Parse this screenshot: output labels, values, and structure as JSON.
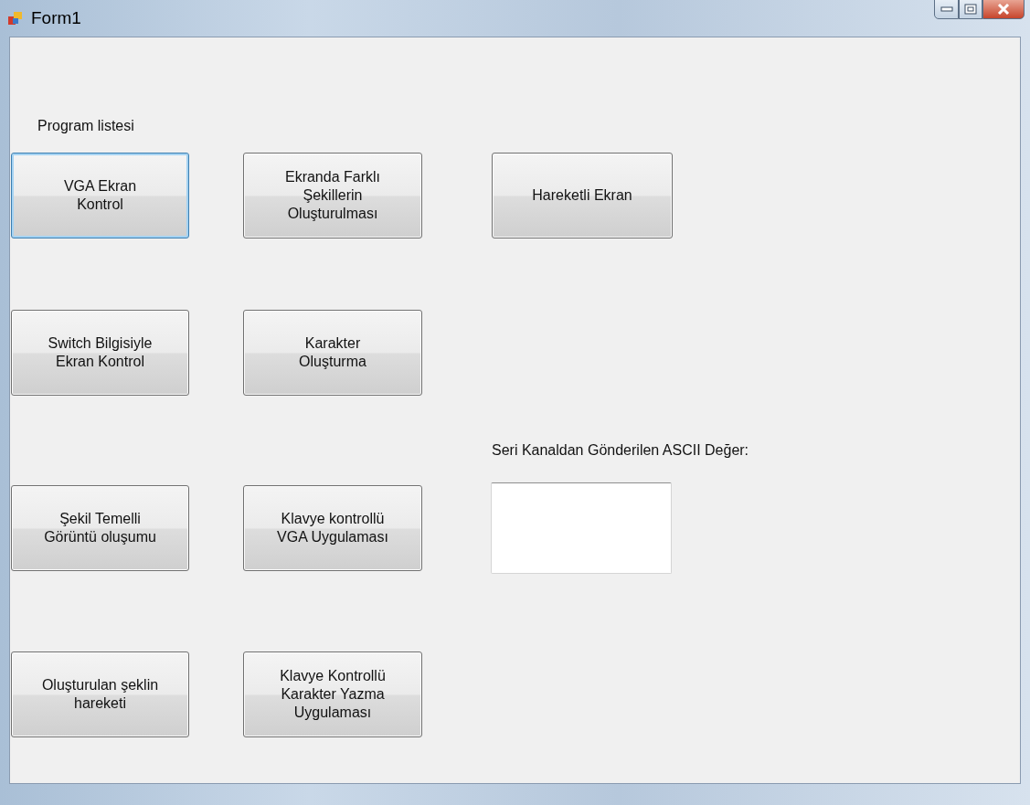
{
  "window": {
    "title": "Form1",
    "controls": [
      {
        "kind": "minimize"
      },
      {
        "kind": "maximize"
      },
      {
        "kind": "close"
      }
    ]
  },
  "section_label": "Program listesi",
  "buttons": [
    {
      "label": "VGA Ekran\nKontrol",
      "focused": true
    },
    {
      "label": "Ekranda Farklı\nŞekillerin\nOluşturulması",
      "focused": false
    },
    {
      "label": "Hareketli Ekran",
      "focused": false
    },
    {
      "label": "Switch Bilgisiyle\nEkran Kontrol",
      "focused": false
    },
    {
      "label": "Karakter\nOluşturma",
      "focused": false
    },
    {
      "label": "Şekil Temelli\nGörüntü oluşumu",
      "focused": false
    },
    {
      "label": "Klavye kontrollü\nVGA Uygulaması",
      "focused": false
    },
    {
      "label": "Oluşturulan şeklin\nhareketi",
      "focused": false
    },
    {
      "label": "Klavye Kontrollü\nKarakter Yazma\nUygulaması",
      "focused": false
    }
  ],
  "ascii": {
    "label": "Seri Kanaldan Gönderilen ASCII Değer:"
  }
}
